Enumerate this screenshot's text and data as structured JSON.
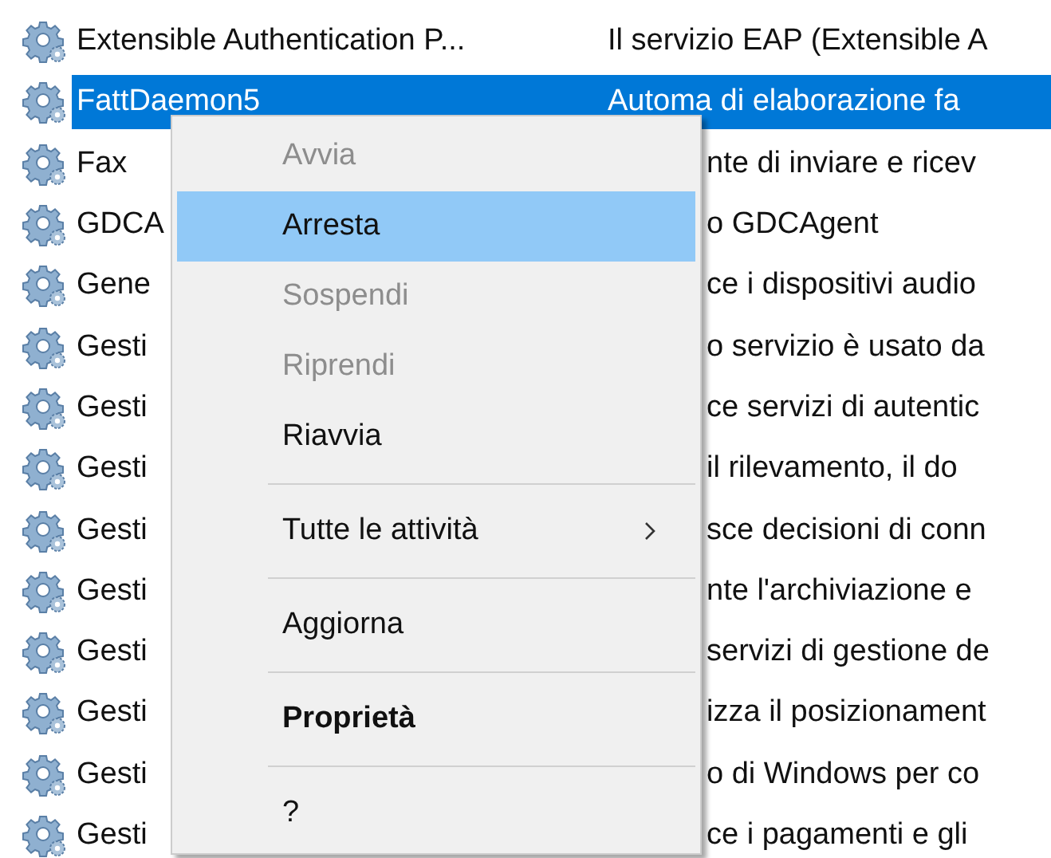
{
  "services": [
    {
      "kind": "full",
      "name": "Extensible Authentication P...",
      "description": "Il servizio EAP (Extensible A",
      "selected": false
    },
    {
      "kind": "full",
      "name": "FattDaemon5",
      "description": "Automa di elaborazione fa",
      "selected": true
    },
    {
      "kind": "clipped",
      "name": "Fax",
      "description": "nte di inviare e ricev",
      "selected": false
    },
    {
      "kind": "clipped",
      "name": "GDCA",
      "description": "o GDCAgent",
      "selected": false
    },
    {
      "kind": "clipped",
      "name": "Gene",
      "description": "ce i dispositivi audio",
      "selected": false
    },
    {
      "kind": "clipped",
      "name": "Gesti",
      "description": "o servizio è usato da",
      "selected": false
    },
    {
      "kind": "clipped",
      "name": "Gesti",
      "description": "ce servizi di autentic",
      "selected": false
    },
    {
      "kind": "clipped",
      "name": "Gesti",
      "description": "il rilevamento, il do",
      "selected": false
    },
    {
      "kind": "clipped",
      "name": "Gesti",
      "description": "sce decisioni di conn",
      "selected": false
    },
    {
      "kind": "clipped",
      "name": "Gesti",
      "description": "nte l'archiviazione e",
      "selected": false
    },
    {
      "kind": "clipped",
      "name": "Gesti",
      "description": "servizi di gestione de",
      "selected": false
    },
    {
      "kind": "clipped",
      "name": "Gesti",
      "description": "izza il posizionament",
      "selected": false
    },
    {
      "kind": "clipped",
      "name": "Gesti",
      "description": "o di Windows per co",
      "selected": false
    },
    {
      "kind": "clipped",
      "name": "Gesti",
      "description": "ce i pagamenti e gli",
      "selected": false
    }
  ],
  "context_menu": {
    "items": [
      {
        "kind": "item",
        "label": "Avvia",
        "disabled": true,
        "selected": false
      },
      {
        "kind": "item",
        "label": "Arresta",
        "disabled": false,
        "selected": true
      },
      {
        "kind": "item",
        "label": "Sospendi",
        "disabled": true,
        "selected": false
      },
      {
        "kind": "item",
        "label": "Riprendi",
        "disabled": true,
        "selected": false
      },
      {
        "kind": "item",
        "label": "Riavvia",
        "disabled": false,
        "selected": false
      },
      {
        "kind": "separator"
      },
      {
        "kind": "submenu",
        "label": "Tutte le attività",
        "disabled": false,
        "selected": false
      },
      {
        "kind": "separator"
      },
      {
        "kind": "item",
        "label": "Aggiorna",
        "disabled": false,
        "selected": false
      },
      {
        "kind": "separator"
      },
      {
        "kind": "default",
        "label": "Proprietà",
        "disabled": false,
        "selected": false
      },
      {
        "kind": "separator"
      },
      {
        "kind": "item",
        "label": "?",
        "disabled": false,
        "selected": false
      }
    ]
  }
}
